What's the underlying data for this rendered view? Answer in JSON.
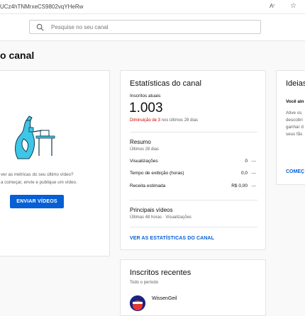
{
  "browser": {
    "url": "UCz4hTNMrxeCS9802vqYHeRw",
    "reader_icon": "Aʳ",
    "favorite_icon": "☆"
  },
  "header": {
    "search_placeholder": "Pesquise no seu canal"
  },
  "page": {
    "title": "o canal"
  },
  "left_card": {
    "line1": "ver as métricas do seu último vídeo?",
    "line2": "a começar, envie e publique um vídeo.",
    "button_label": "ENVIAR VÍDEOS"
  },
  "stats_card": {
    "title": "Estatísticas do canal",
    "subscribers_label": "Inscritos atuais",
    "subscribers_value": "1.003",
    "change_prefix": "Diminuição de 3",
    "change_suffix": " nos últimos 28 dias",
    "summary_title": "Resumo",
    "summary_period": "Últimos 28 dias",
    "metrics": [
      {
        "label": "Visualizações",
        "value": "0",
        "dash": "—"
      },
      {
        "label": "Tempo de exibição (horas)",
        "value": "0,0",
        "dash": "—"
      },
      {
        "label": "Receita estimada",
        "value": "R$ 0,00",
        "dash": "—"
      }
    ],
    "top_videos_title": "Principais vídeos",
    "top_videos_period": "Últimas 48 horas · Visualizações",
    "link_label": "VER AS ESTATÍSTICAS DO CANAL"
  },
  "ideas_card": {
    "title": "Ideias",
    "subtitle": "Você ain",
    "lines": [
      "Ative os",
      "descobri",
      "ganhar d",
      "seus fãs"
    ],
    "link_label": "COMEÇ"
  },
  "recent_subs_card": {
    "title": "Inscritos recentes",
    "period": "Todo o período",
    "subscriber_name": "WissenGeil"
  },
  "colors": {
    "accent": "#065fd4",
    "negative": "#cc0000",
    "illustration": "#3ec6e8"
  }
}
